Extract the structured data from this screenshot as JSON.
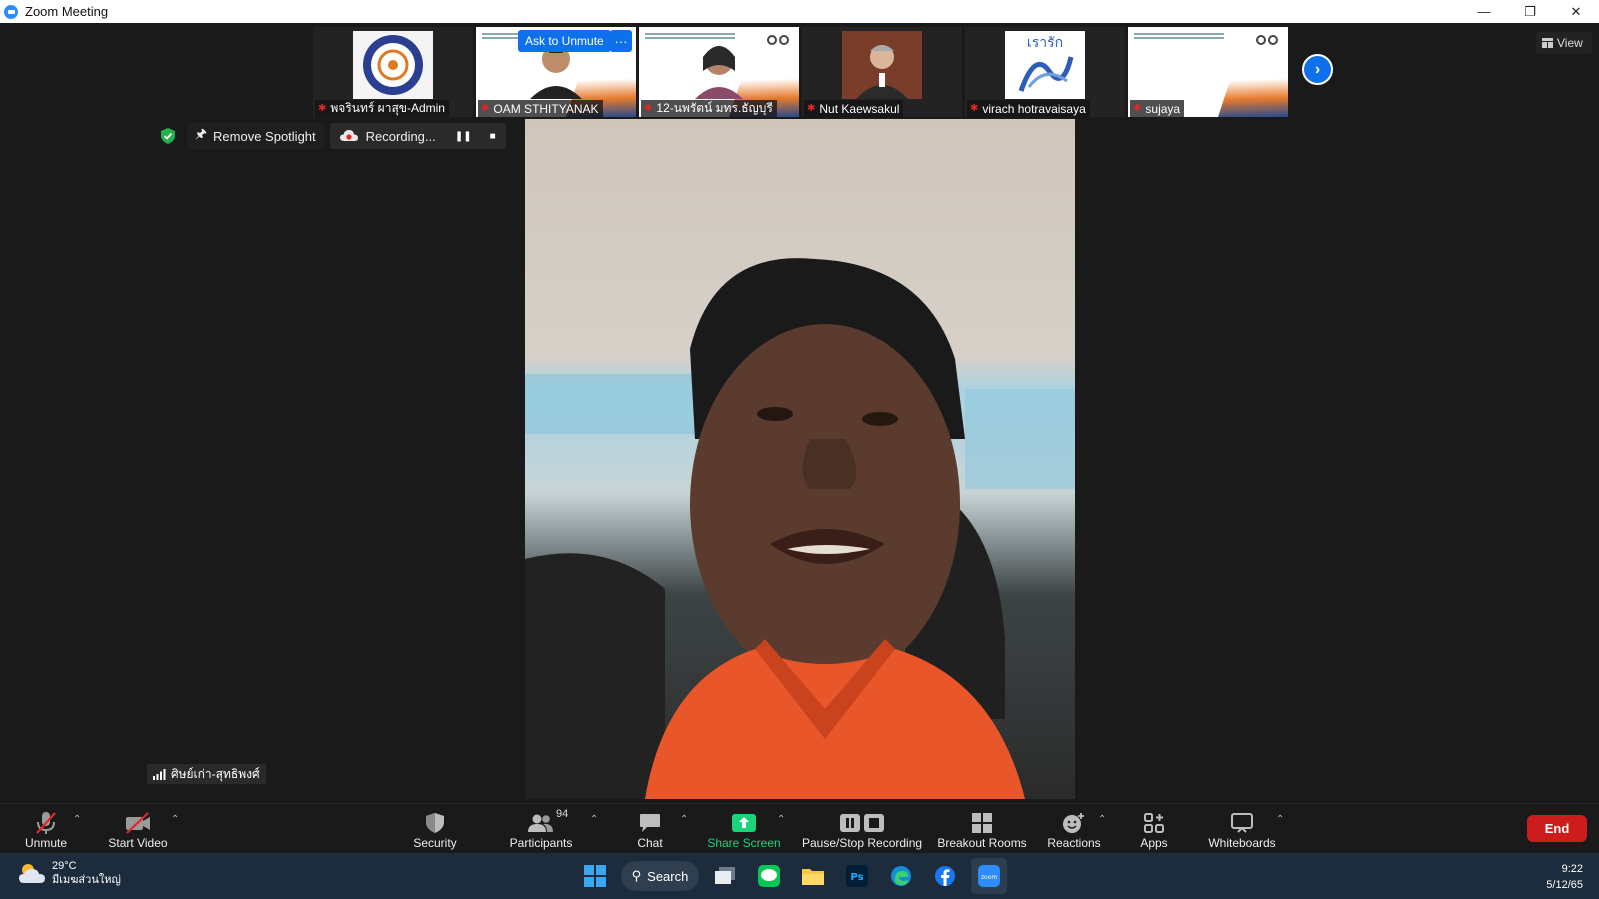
{
  "window": {
    "title": "Zoom Meeting"
  },
  "strip": {
    "participants": [
      {
        "name": "พจรินทร์ ผาสุข-Admin",
        "kind": "logo"
      },
      {
        "name": "OAM STHITYANAK",
        "kind": "person"
      },
      {
        "name": "12-นพรัตน์ มทร.ธัญบุรี",
        "kind": "slide"
      },
      {
        "name": "Nut Kaewsakul",
        "kind": "person"
      },
      {
        "name": "virach hotravaisaya",
        "kind": "logo"
      },
      {
        "name": "sujaya",
        "kind": "slide"
      }
    ],
    "ask_to_unmute": "Ask to Unmute",
    "more_dots": "···",
    "view_label": "View"
  },
  "floatbar": {
    "remove_spotlight": "Remove Spotlight",
    "recording": "Recording..."
  },
  "stage": {
    "active_speaker": "ศิษย์เก่า-สุทธิพงศ์"
  },
  "toolbar": {
    "unmute": "Unmute",
    "start_video": "Start Video",
    "security": "Security",
    "participants": "Participants",
    "participant_count": "94",
    "chat": "Chat",
    "share_screen": "Share Screen",
    "pause_stop_recording": "Pause/Stop Recording",
    "breakout_rooms": "Breakout Rooms",
    "reactions": "Reactions",
    "apps": "Apps",
    "whiteboards": "Whiteboards",
    "end": "End"
  },
  "taskbar": {
    "temperature": "29°C",
    "weather_text": "มีเมฆส่วนใหญ่",
    "search_label": "Search",
    "time": "9:22",
    "date": "5/12/65"
  },
  "colors": {
    "accent": "#0e71eb",
    "end": "#cc1c1c",
    "share_green": "#1ad37a",
    "muted_red": "#e02828"
  }
}
